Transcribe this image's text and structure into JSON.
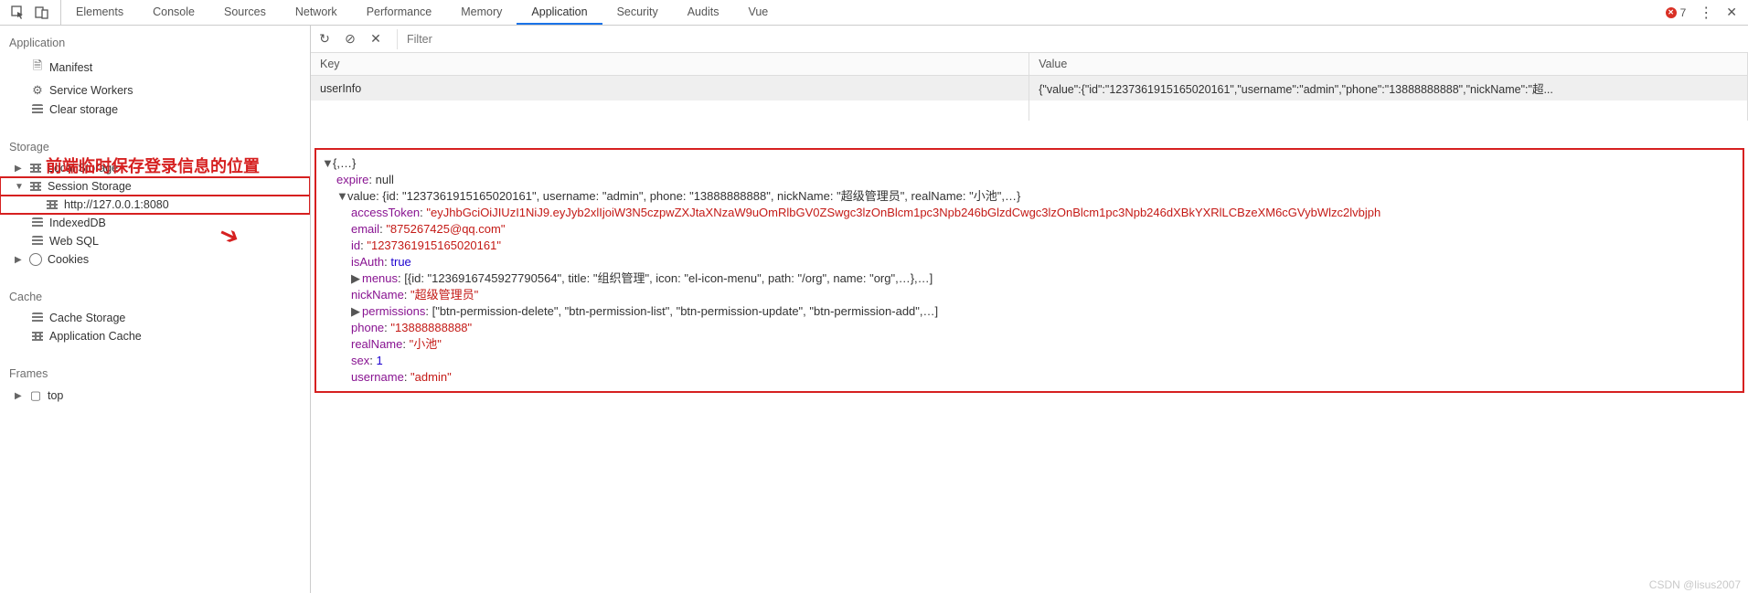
{
  "topTabs": [
    "Elements",
    "Console",
    "Sources",
    "Network",
    "Performance",
    "Memory",
    "Application",
    "Security",
    "Audits",
    "Vue"
  ],
  "activeTab": "Application",
  "errorCount": "7",
  "sidebar": {
    "groups": {
      "application": {
        "label": "Application",
        "items": [
          "Manifest",
          "Service Workers",
          "Clear storage"
        ]
      },
      "storage": {
        "label": "Storage",
        "localStorage": "Local Storage",
        "sessionStorage": "Session Storage",
        "sessionItem": "http://127.0.0.1:8080",
        "indexedDb": "IndexedDB",
        "webSql": "Web SQL",
        "cookies": "Cookies"
      },
      "cache": {
        "label": "Cache",
        "items": [
          "Cache Storage",
          "Application Cache"
        ]
      },
      "frames": {
        "label": "Frames",
        "top": "top"
      }
    }
  },
  "annotation": {
    "text": "前端临时保存登录信息的位置"
  },
  "toolbar": {
    "filterPlaceholder": "Filter"
  },
  "table": {
    "headers": {
      "key": "Key",
      "value": "Value"
    },
    "row": {
      "key": "userInfo",
      "value": "{\"value\":{\"id\":\"1237361915165020161\",\"username\":\"admin\",\"phone\":\"13888888888\",\"nickName\":\"超..."
    }
  },
  "detail": {
    "expire": "null",
    "valueSummary": "value: {id: \"1237361915165020161\", username: \"admin\", phone: \"13888888888\", nickName: \"超级管理员\", realName: \"小池\",…}",
    "accessToken": "\"eyJhbGciOiJIUzI1NiJ9.eyJyb2xlIjoiW3N5czpwZXJtaXNzaW9uOmRlbGV0ZSwgc3lzOnBlcm1pc3Npb246bGlzdCwgc3lzOnBlcm1pc3Npb246dXBkYXRlLCBzeXM6cGVybWlzc2lvbjph",
    "email": "\"875267425@qq.com\"",
    "id": "\"1237361915165020161\"",
    "isAuth": "true",
    "menus": "[{id: \"1236916745927790564\", title: \"组织管理\", icon: \"el-icon-menu\", path: \"/org\", name: \"org\",…},…]",
    "nickName": "\"超级管理员\"",
    "permissions": "[\"btn-permission-delete\", \"btn-permission-list\", \"btn-permission-update\", \"btn-permission-add\",…]",
    "phone": "\"13888888888\"",
    "realName": "\"小池\"",
    "sex": "1",
    "username": "\"admin\""
  },
  "watermark": "CSDN @lisus2007"
}
